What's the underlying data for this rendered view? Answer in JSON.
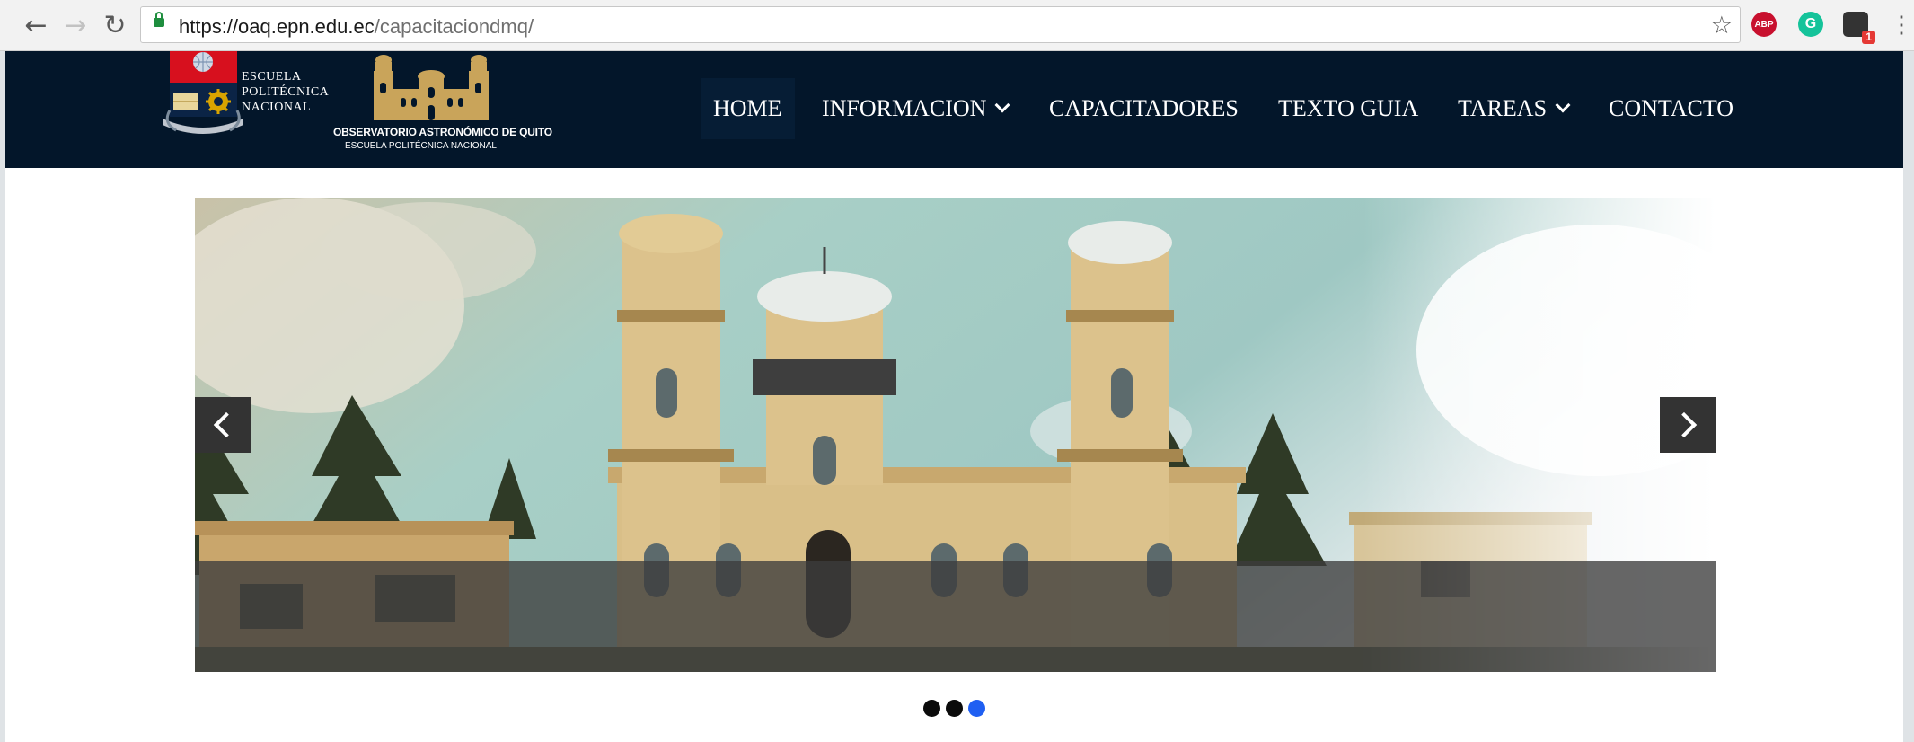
{
  "browser": {
    "url_host": "https://oaq.epn.edu.ec",
    "url_path": "/capacitaciondmq/",
    "extensions": [
      {
        "name": "adblock-plus",
        "label": "ABP"
      },
      {
        "name": "grammarly",
        "label": "G"
      },
      {
        "name": "extension-badge",
        "badge": "1"
      }
    ]
  },
  "site": {
    "epn_logo_text": [
      "ESCUELA",
      "POLITÉCNICA",
      "NACIONAL"
    ],
    "oaq_title": "OBSERVATORIO ASTRONÓMICO DE QUITO",
    "oaq_subtitle": "ESCUELA POLITÉCNICA NACIONAL",
    "menu": [
      {
        "label": "HOME",
        "active": true
      },
      {
        "label": "INFORMACION",
        "dropdown": true
      },
      {
        "label": "CAPACITADORES"
      },
      {
        "label": "TEXTO GUIA"
      },
      {
        "label": "TAREAS",
        "dropdown": true
      },
      {
        "label": "CONTACTO"
      }
    ]
  },
  "carousel": {
    "slide_count": 3,
    "active_index": 2
  },
  "colors": {
    "nav_bg": "#03162a",
    "accent_dot": "#1f5ff2"
  }
}
